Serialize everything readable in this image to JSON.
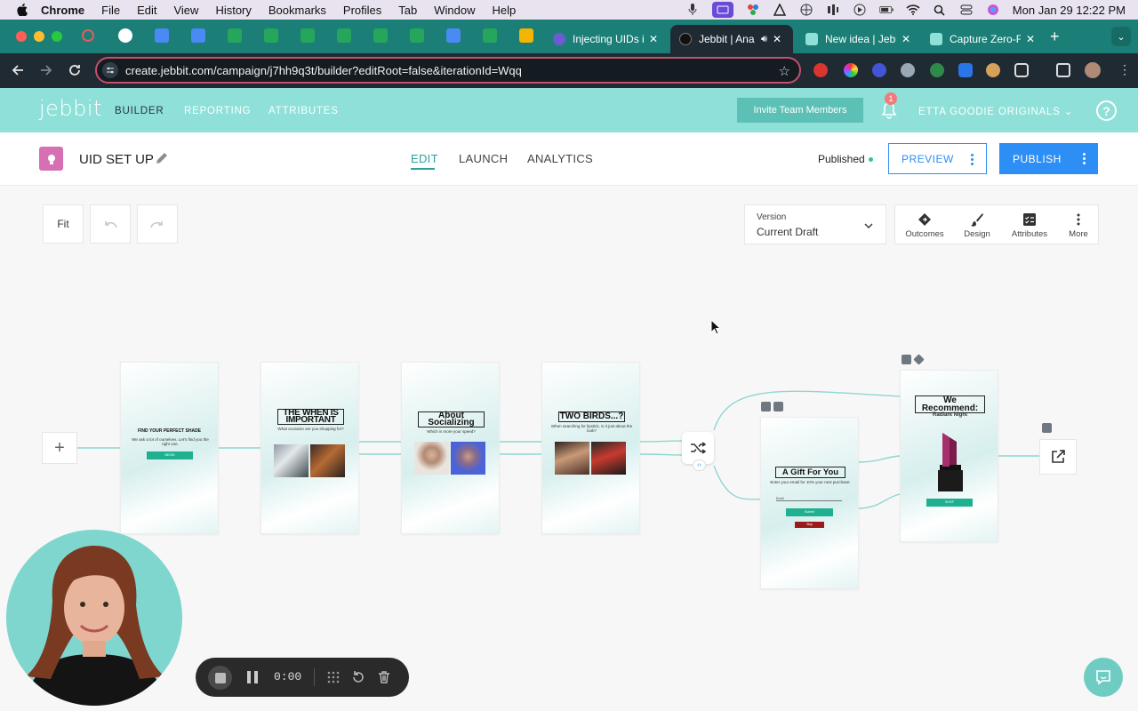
{
  "menubar": {
    "app": "Chrome",
    "items": [
      "File",
      "Edit",
      "View",
      "History",
      "Bookmarks",
      "Profiles",
      "Tab",
      "Window",
      "Help"
    ],
    "clock": "Mon Jan 29  12:22 PM"
  },
  "browser": {
    "tabs": [
      {
        "title": "Injecting UIDs i",
        "favicon_color": "#6d5bd0"
      },
      {
        "title": "Jebbit | Ana",
        "favicon_color": "#1d1d1d"
      },
      {
        "title": "New idea | Jebl",
        "favicon_color": "#8ee0d9"
      },
      {
        "title": "Capture Zero-F",
        "favicon_color": "#8ee0d9"
      }
    ],
    "url": "create.jebbit.com/campaign/j7hh9q3t/builder?editRoot=false&iterationId=Wqq"
  },
  "app_header": {
    "logo": "jebbit",
    "nav": [
      "BUILDER",
      "REPORTING",
      "ATTRIBUTES"
    ],
    "invite_label": "Invite Team Members",
    "notification_count": "1",
    "account": "ETTA GOODIE ORIGINALS",
    "help": "?"
  },
  "campaign": {
    "title": "UID SET UP",
    "tabs": [
      "EDIT",
      "LAUNCH",
      "ANALYTICS"
    ],
    "status": "Published",
    "preview_label": "PREVIEW",
    "publish_label": "PUBLISH"
  },
  "canvas": {
    "fit_label": "Fit",
    "version_label": "Version",
    "version_value": "Current Draft",
    "tools": [
      "Outcomes",
      "Design",
      "Attributes",
      "More"
    ]
  },
  "flow": {
    "screen1": {
      "title": "FIND YOUR PERFECT SHADE",
      "sub": "We ask a lot of ourselves. Let's find you the right one.",
      "btn": "BEGIN"
    },
    "screen2": {
      "title": "THE WHEN IS IMPORTANT",
      "sub": "What occasion are you shopping for?"
    },
    "screen3": {
      "title": "About Socializing",
      "sub": "Which is more your speed?"
    },
    "screen4": {
      "title": "TWO BIRDS...?",
      "sub": "When searching for lipstick, is it just about the look?"
    },
    "screen5": {
      "title": "A Gift For You",
      "sub": "Enter your email for 10% your next purchase:",
      "field": "Email",
      "btn": "Submit",
      "btn2": "Skip"
    },
    "screen6": {
      "title": "We Recommend:",
      "sub": "Radiant Night",
      "btn": "SHOP"
    }
  },
  "recorder": {
    "time": "0:00"
  },
  "colors": {
    "brand": "#8ee0d9",
    "accent": "#2d8ef5",
    "teal_text": "#2aa39a"
  }
}
